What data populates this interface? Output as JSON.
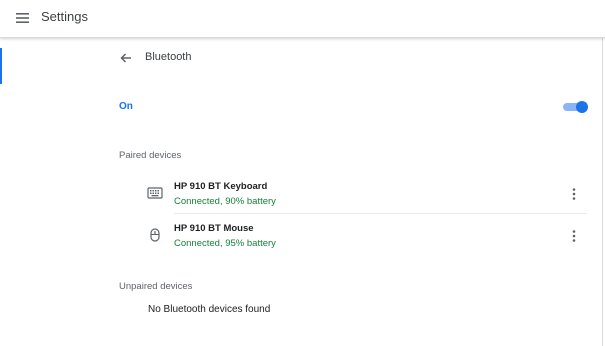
{
  "app": {
    "title": "Settings"
  },
  "page": {
    "title": "Bluetooth"
  },
  "bluetooth": {
    "state_label": "On",
    "enabled": true
  },
  "paired": {
    "label": "Paired devices",
    "devices": [
      {
        "name": "HP 910 BT Keyboard",
        "status": "Connected, 90% battery",
        "icon": "keyboard-icon"
      },
      {
        "name": "HP 910 BT Mouse",
        "status": "Connected, 95% battery",
        "icon": "mouse-icon"
      }
    ]
  },
  "unpaired": {
    "label": "Unpaired devices",
    "empty_text": "No Bluetooth devices found"
  },
  "colors": {
    "accent": "#1a73e8",
    "status_connected": "#188038",
    "toggle_track": "#8ab4f8"
  }
}
